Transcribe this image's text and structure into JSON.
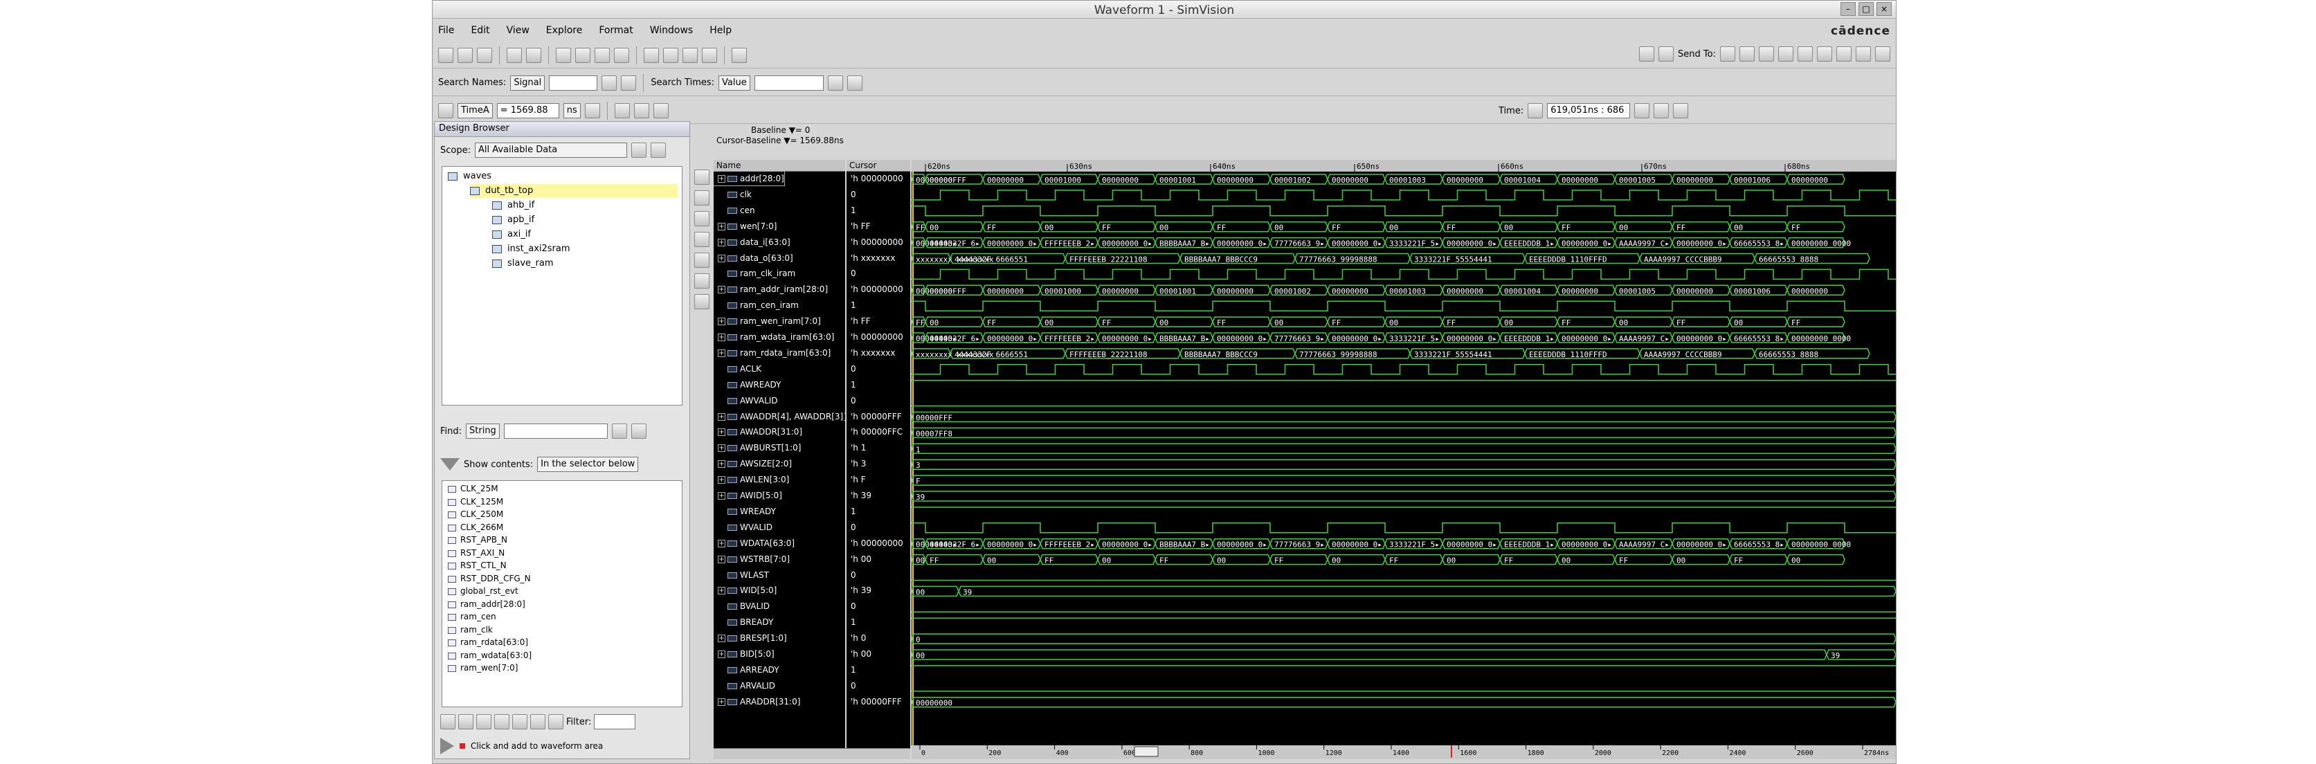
{
  "window": {
    "title": "Waveform 1 - SimVision",
    "brand": "cādence"
  },
  "menu": [
    "File",
    "Edit",
    "View",
    "Explore",
    "Format",
    "Windows",
    "Help"
  ],
  "toolbar2": {
    "search_names_label": "Search Names:",
    "search_names_value": "Signal",
    "search_times_label": "Search Times:",
    "search_times_value": "Value",
    "send_to_label": "Send To:"
  },
  "toolbar3": {
    "time_mode": "TimeA",
    "time_value": "= 1569.88",
    "time_unit": "ns",
    "time_label": "Time:",
    "time_range": "619,051ns : 686"
  },
  "design_browser": {
    "title": "Design Browser",
    "scope_label": "Scope:",
    "scope_value": "All Available Data",
    "tree": [
      "waves",
      "dut_tb_top",
      "ahb_if",
      "apb_if",
      "axi_if",
      "inst_axi2sram",
      "slave_ram"
    ],
    "find_label": "Find:",
    "find_value": "String",
    "show_contents_label": "Show contents:",
    "show_contents_value": "In the selector below",
    "signals": [
      "CLK_25M",
      "CLK_125M",
      "CLK_250M",
      "CLK_266M",
      "RST_APB_N",
      "RST_AXI_N",
      "RST_CTL_N",
      "RST_DDR_CFG_N",
      "global_rst_evt",
      "ram_addr[28:0]",
      "ram_cen",
      "ram_clk",
      "ram_rdata[63:0]",
      "ram_wdata[63:0]",
      "ram_wen[7:0]"
    ],
    "filter_label": "Filter:",
    "hint": "Click and add to waveform area"
  },
  "baseline": {
    "line1": "Baseline ▼= 0",
    "line2": "Cursor-Baseline ▼= 1569.88ns"
  },
  "columns": {
    "name": "Name",
    "cursor": "Cursor"
  },
  "time_ticks": [
    "620ns",
    "630ns",
    "640ns",
    "650ns",
    "660ns",
    "670ns",
    "680ns"
  ],
  "rows": [
    {
      "name": "addr[28:0]",
      "cursor": "'h 00000000",
      "bus": true,
      "vals": [
        "00000000",
        "00000FFF",
        "00000000",
        "00001000",
        "00000000",
        "00001001",
        "00000000",
        "00001002",
        "00000000",
        "00001003",
        "00000000",
        "00001004",
        "00000000",
        "00001005",
        "00000000",
        "00001006",
        "00000000"
      ]
    },
    {
      "name": "clk",
      "cursor": "0",
      "bus": false,
      "clk": true
    },
    {
      "name": "cen",
      "cursor": "1",
      "bus": false,
      "pat": "pulse"
    },
    {
      "name": "wen[7:0]",
      "cursor": "'h FF",
      "bus": true,
      "vals": [
        "FF",
        "00",
        "FF",
        "00",
        "FF",
        "00",
        "FF",
        "00",
        "FF",
        "00",
        "FF",
        "00",
        "FF",
        "00",
        "FF",
        "00",
        "FF"
      ]
    },
    {
      "name": "data_i[63:0]",
      "cursor": "'h 00000000",
      "bus": true,
      "vals": [
        "00000000▸",
        "4444332F_6▸",
        "00000000_0▸",
        "FFFFEEEB_2▸",
        "00000000_0▸",
        "BBBBAAA7_B▸",
        "00000000_0▸",
        "77776663_9▸",
        "00000000_0▸",
        "3333221F_5▸",
        "00000000_0▸",
        "EEEEDDDB_1▸",
        "00000000_0▸",
        "AAAA9997_C▸",
        "00000000_0▸",
        "66665553_8▸",
        "00000000_0000"
      ]
    },
    {
      "name": "data_o[63:0]",
      "cursor": "'h xxxxxxx",
      "bus": true,
      "vals": [
        "xxxxxxxx_xxxxxxxx",
        "4444332F_6666551",
        "FFFFEEEB_22221108",
        "BBBBAAA7_BBBCCC9",
        "77776663_99998888",
        "3333221F_55554441",
        "EEEEDDDB_1110FFFD",
        "AAAA9997_CCCCBBB9",
        "66665553_8888"
      ]
    },
    {
      "name": "ram_clk_iram",
      "cursor": "0",
      "bus": false,
      "clk": true
    },
    {
      "name": "ram_addr_iram[28:0]",
      "cursor": "'h 00000000",
      "bus": true,
      "vals": [
        "00000000",
        "00000FFF",
        "00000000",
        "00001000",
        "00000000",
        "00001001",
        "00000000",
        "00001002",
        "00000000",
        "00001003",
        "00000000",
        "00001004",
        "00000000",
        "00001005",
        "00000000",
        "00001006",
        "00000000"
      ]
    },
    {
      "name": "ram_cen_iram",
      "cursor": "1",
      "bus": false,
      "pat": "pulse"
    },
    {
      "name": "ram_wen_iram[7:0]",
      "cursor": "'h FF",
      "bus": true,
      "vals": [
        "FF",
        "00",
        "FF",
        "00",
        "FF",
        "00",
        "FF",
        "00",
        "FF",
        "00",
        "FF",
        "00",
        "FF",
        "00",
        "FF",
        "00",
        "FF"
      ]
    },
    {
      "name": "ram_wdata_iram[63:0]",
      "cursor": "'h 00000000",
      "bus": true,
      "vals": [
        "00000000▸",
        "4444332F_6▸",
        "00000000_0▸",
        "FFFFEEEB_2▸",
        "00000000_0▸",
        "BBBBAAA7_B▸",
        "00000000_0▸",
        "77776663_9▸",
        "00000000_0▸",
        "3333221F_5▸",
        "00000000_0▸",
        "EEEEDDDB_1▸",
        "00000000_0▸",
        "AAAA9997_C▸",
        "00000000_0▸",
        "66665553_8▸",
        "00000000_0000"
      ]
    },
    {
      "name": "ram_rdata_iram[63:0]",
      "cursor": "'h xxxxxxx",
      "bus": true,
      "vals": [
        "xxxxxxxx_xxxxxxxx",
        "4444332F_6666551",
        "FFFFEEEB_22221108",
        "BBBBAAA7_BBBCCC9",
        "77776663_99998888",
        "3333221F_55554441",
        "EEEEDDDB_1110FFFD",
        "AAAA9997_CCCCBBB9",
        "66665553_8888"
      ]
    },
    {
      "name": "ACLK",
      "cursor": "0",
      "bus": false,
      "clk": true
    },
    {
      "name": "AWREADY",
      "cursor": "1",
      "bus": false,
      "pat": "high"
    },
    {
      "name": "AWVALID",
      "cursor": "0",
      "bus": false,
      "pat": "low"
    },
    {
      "name": "AWADDR[4], AWADDR[3]}",
      "cursor": "'h 00000FFF",
      "bus": true,
      "vals": [
        "00000FFF"
      ]
    },
    {
      "name": "AWADDR[31:0]",
      "cursor": "'h 00000FFC",
      "bus": true,
      "vals": [
        "00007FF8"
      ]
    },
    {
      "name": "AWBURST[1:0]",
      "cursor": "'h 1",
      "bus": true,
      "vals": [
        "1"
      ]
    },
    {
      "name": "AWSIZE[2:0]",
      "cursor": "'h 3",
      "bus": true,
      "vals": [
        "3"
      ]
    },
    {
      "name": "AWLEN[3:0]",
      "cursor": "'h F",
      "bus": true,
      "vals": [
        "F"
      ]
    },
    {
      "name": "AWID[5:0]",
      "cursor": "'h 39",
      "bus": true,
      "vals": [
        "39"
      ]
    },
    {
      "name": "WREADY",
      "cursor": "1",
      "bus": false,
      "pat": "high"
    },
    {
      "name": "WVALID",
      "cursor": "0",
      "bus": false,
      "pat": "pulse"
    },
    {
      "name": "WDATA[63:0]",
      "cursor": "'h 00000000",
      "bus": true,
      "vals": [
        "00000000▸",
        "4444332F_6▸",
        "00000000_0▸",
        "FFFFEEEB_2▸",
        "00000000_0▸",
        "BBBBAAA7_B▸",
        "00000000_0▸",
        "77776663_9▸",
        "00000000_0▸",
        "3333221F_5▸",
        "00000000_0▸",
        "EEEEDDDB_1▸",
        "00000000_0▸",
        "AAAA9997_C▸",
        "00000000_0▸",
        "66665553_8▸",
        "00000000_0000"
      ]
    },
    {
      "name": "WSTRB[7:0]",
      "cursor": "'h 00",
      "bus": true,
      "vals": [
        "00",
        "FF",
        "00",
        "FF",
        "00",
        "FF",
        "00",
        "FF",
        "00",
        "FF",
        "00",
        "FF",
        "00",
        "FF",
        "00",
        "FF",
        "00"
      ]
    },
    {
      "name": "WLAST",
      "cursor": "0",
      "bus": false,
      "pat": "low"
    },
    {
      "name": "WID[5:0]",
      "cursor": "'h 39",
      "bus": true,
      "vals": [
        "00",
        "39"
      ]
    },
    {
      "name": "BVALID",
      "cursor": "0",
      "bus": false,
      "pat": "low"
    },
    {
      "name": "BREADY",
      "cursor": "1",
      "bus": false,
      "pat": "high"
    },
    {
      "name": "BRESP[1:0]",
      "cursor": "'h 0",
      "bus": true,
      "vals": [
        "0"
      ]
    },
    {
      "name": "BID[5:0]",
      "cursor": "'h 00",
      "bus": true,
      "vals": [
        "00",
        "39"
      ]
    },
    {
      "name": "ARREADY",
      "cursor": "1",
      "bus": false,
      "pat": "high"
    },
    {
      "name": "ARVALID",
      "cursor": "0",
      "bus": false,
      "pat": "low"
    },
    {
      "name": "ARADDR[31:0]",
      "cursor": "'h 00000FFF",
      "bus": true,
      "vals": [
        "00000000"
      ]
    }
  ],
  "bottom_ruler": [
    "0",
    "200",
    "400",
    "600",
    "800",
    "1000",
    "1200",
    "1400",
    "1600",
    "1800",
    "2000",
    "2200",
    "2400",
    "2600",
    "2784ns"
  ],
  "colors": {
    "wave": "#36d536",
    "bg": "#000000",
    "baseline": "#ffd700",
    "header": "#c4c4c4"
  }
}
